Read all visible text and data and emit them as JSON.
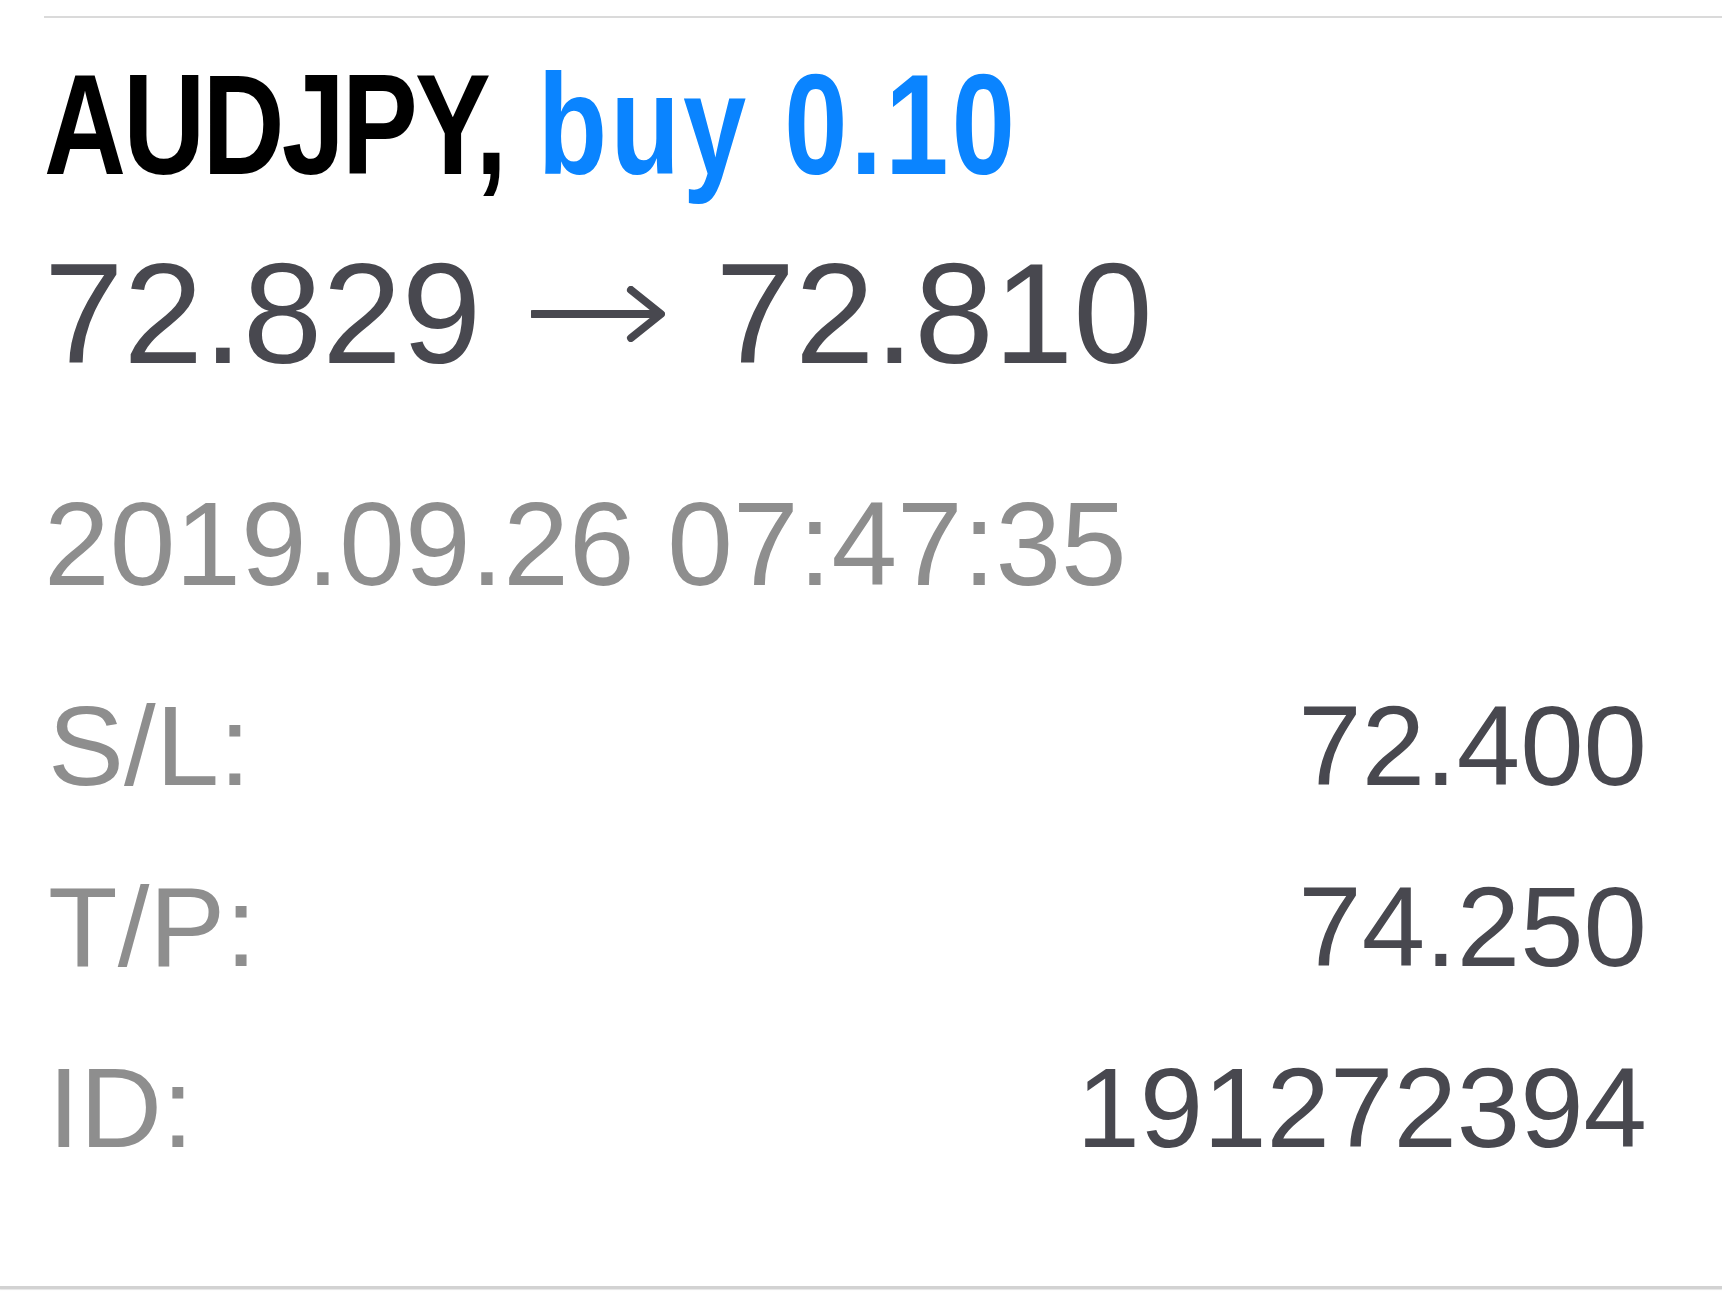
{
  "position": {
    "symbol": "AUDJPY,",
    "order": "buy 0.10",
    "open_price": "72.829",
    "current_price": "72.810",
    "time": "2019.09.26 07:47:35",
    "details": [
      {
        "label": "S/L:",
        "value": "72.400"
      },
      {
        "label": "T/P:",
        "value": "74.250"
      },
      {
        "label": "ID:",
        "value": "191272394"
      }
    ]
  }
}
